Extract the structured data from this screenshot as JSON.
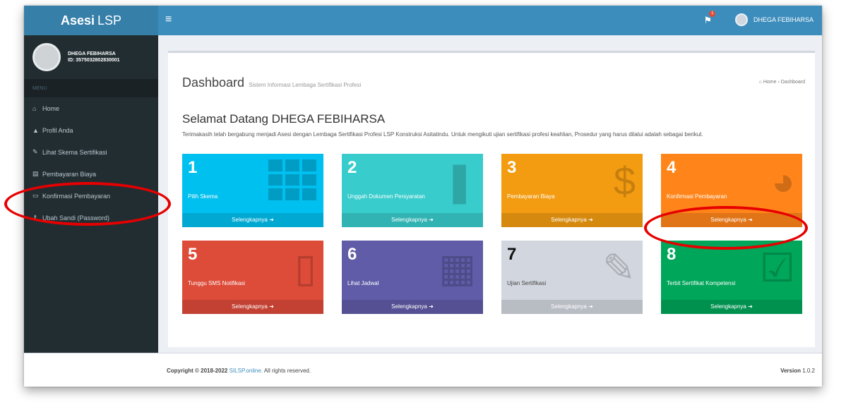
{
  "app": {
    "logo_bold": "Asesi",
    "logo_rest": "LSP"
  },
  "topbar": {
    "menu_toggle": "≡",
    "user_name": "DHEGA FEBIHARSA",
    "notif_count": "1"
  },
  "user_panel": {
    "name": "DHEGA FEBIHARSA",
    "id": "ID: 357503280283000​1"
  },
  "sidebar": {
    "header": "MENU",
    "items": [
      {
        "icon": "home-icon",
        "label": "Home"
      },
      {
        "icon": "user-icon",
        "label": "Profil Anda"
      },
      {
        "icon": "edit-icon",
        "label": "Lihat Skema Sertifikasi"
      },
      {
        "icon": "document-icon",
        "label": "Pembayaran Biaya"
      },
      {
        "icon": "card-icon",
        "label": "Konfirmasi Pembayaran"
      },
      {
        "icon": "key-icon",
        "label": "Ubah Sandi (Password)"
      }
    ]
  },
  "page": {
    "title": "Dashboard",
    "subtitle": "Sistem Informasi Lembaga Sertifikasi Profesi",
    "breadcrumb_home": "Home",
    "breadcrumb_current": "Dashboard",
    "welcome": "Selamat Datang DHEGA FEBIHARSA",
    "intro": "Terimakasih telah bergabung menjadi Asesi dengan Lembaga Sertifikasi Profesi LSP Konstruksi Asitatindu. Untuk mengikuti ujian sertifikasi profesi keahlian, Prosedur yang harus dilalui adalah sebagai berikut."
  },
  "tiles": [
    {
      "num": "1",
      "label": "Pilih Skema",
      "more": "Selengkapnya",
      "color": "#00c0ef",
      "icon": "grid-icon"
    },
    {
      "num": "2",
      "label": "Unggah Dokumen Persyaratan",
      "more": "Selengkapnya",
      "color": "#39cccc",
      "icon": "bookmark-icon"
    },
    {
      "num": "3",
      "label": "Pembayaran Biaya",
      "more": "Selengkapnya",
      "color": "#f39c12",
      "icon": "dollar-icon"
    },
    {
      "num": "4",
      "label": "Konfirmasi Pembayaran",
      "more": "Selengkapnya",
      "color": "#ff851b",
      "icon": "pie-chart-icon"
    },
    {
      "num": "5",
      "label": "Tunggu SMS Notifikasi",
      "more": "Selengkapnya",
      "color": "#dd4b39",
      "icon": "mobile-icon"
    },
    {
      "num": "6",
      "label": "Lihat Jadwal",
      "more": "Selengkapnya",
      "color": "#605ca8",
      "icon": "calendar-icon"
    },
    {
      "num": "7",
      "label": "Ujian Sertifikasi",
      "more": "Selengkapnya",
      "color": "#d2d6de",
      "icon": "edit-icon"
    },
    {
      "num": "8",
      "label": "Terbit Sertifikat Kompetensi",
      "more": "Selengkapnya",
      "color": "#00a65a",
      "icon": "check-icon"
    }
  ],
  "footer": {
    "copy_prefix": "Copyright © 2018-2022",
    "copy_link": "SILSP.online.",
    "copy_suffix": "All rights reserved.",
    "version_label": "Version",
    "version": "1.0.2"
  }
}
